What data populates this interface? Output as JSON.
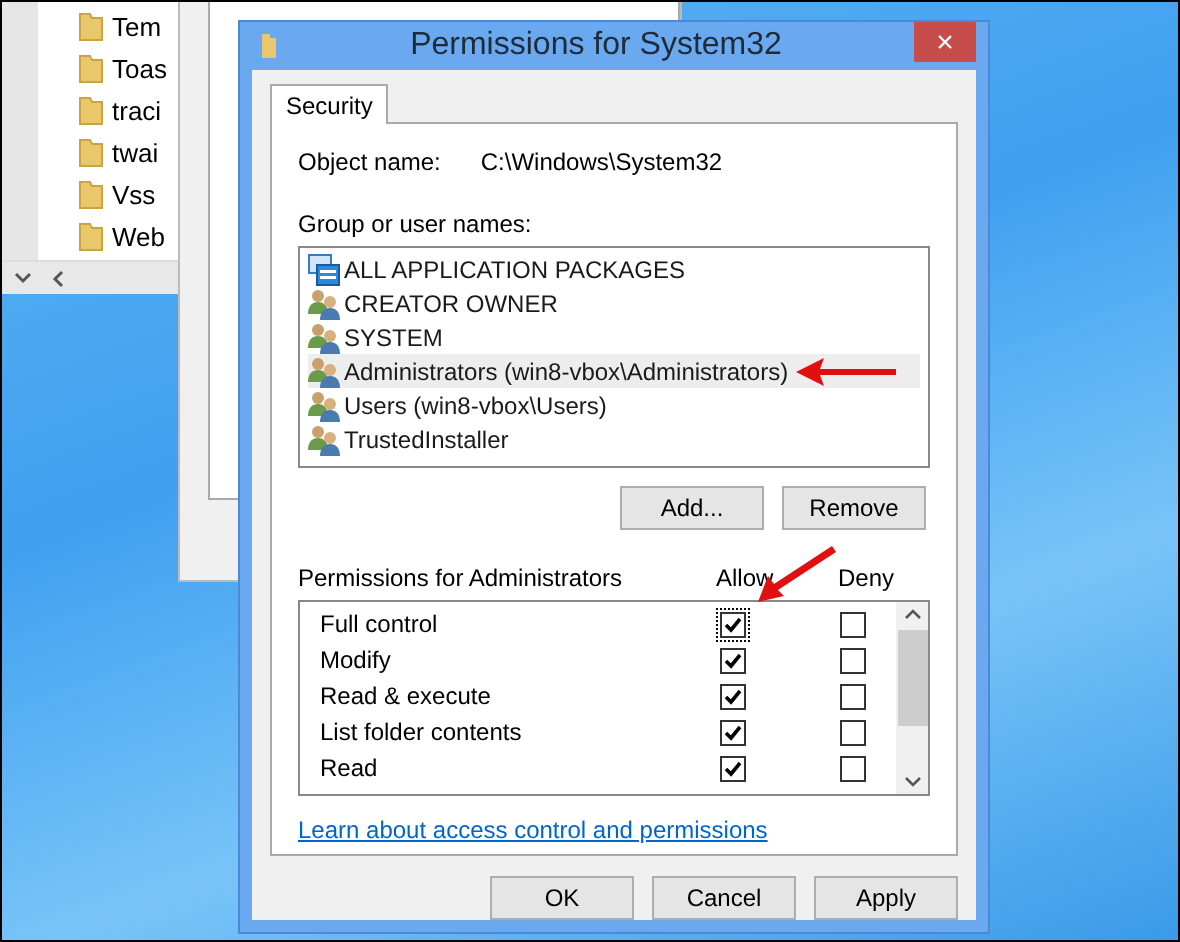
{
  "explorer": {
    "folders": [
      "Tem",
      "Toas",
      "traci",
      "twai",
      "Vss",
      "Web"
    ]
  },
  "dialog": {
    "title": "Permissions for System32",
    "close": "×",
    "tabs": [
      {
        "label": "Security",
        "selected": true
      }
    ],
    "object_name": {
      "label": "Object name:",
      "value": "C:\\Windows\\System32"
    },
    "groups_label": "Group or user names:",
    "groups": [
      {
        "name": "ALL APPLICATION PACKAGES",
        "kind": "package",
        "selected": false
      },
      {
        "name": "CREATOR OWNER",
        "kind": "users",
        "selected": false
      },
      {
        "name": "SYSTEM",
        "kind": "users",
        "selected": false
      },
      {
        "name": "Administrators (win8-vbox\\Administrators)",
        "kind": "users",
        "selected": true
      },
      {
        "name": "Users (win8-vbox\\Users)",
        "kind": "users",
        "selected": false
      },
      {
        "name": "TrustedInstaller",
        "kind": "users",
        "selected": false
      }
    ],
    "group_buttons": [
      "Add...",
      "Remove"
    ],
    "permissions": {
      "label": "Permissions for Administrators",
      "allow_label": "Allow",
      "deny_label": "Deny",
      "rows": [
        {
          "name": "Full control",
          "allow": true,
          "deny": false,
          "focused": true
        },
        {
          "name": "Modify",
          "allow": true,
          "deny": false,
          "focused": false
        },
        {
          "name": "Read & execute",
          "allow": true,
          "deny": false,
          "focused": false
        },
        {
          "name": "List folder contents",
          "allow": true,
          "deny": false,
          "focused": false
        },
        {
          "name": "Read",
          "allow": true,
          "deny": false,
          "focused": false
        }
      ]
    },
    "link": "Learn about access control and permissions",
    "buttons": [
      "OK",
      "Cancel",
      "Apply"
    ]
  }
}
